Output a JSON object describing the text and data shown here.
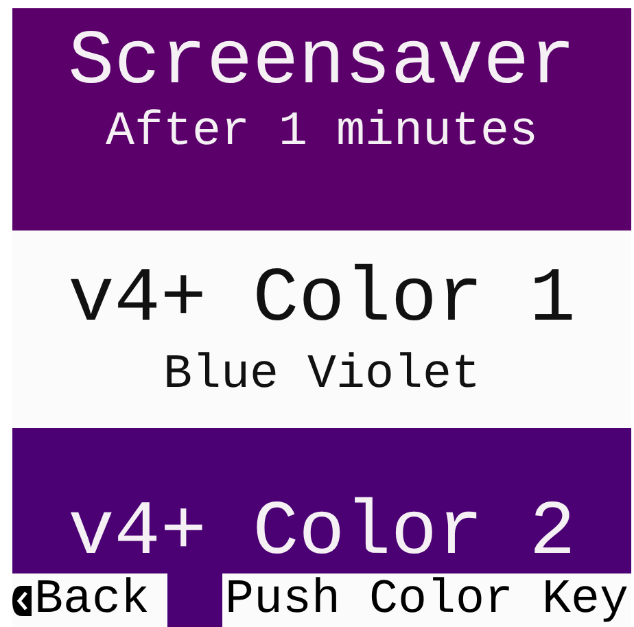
{
  "menu": [
    {
      "title": "Screensaver",
      "subtitle": "After 1 minutes",
      "selected": false,
      "color": "#5b006b"
    },
    {
      "title": "v4+ Color 1",
      "subtitle": "Blue Violet",
      "selected": true
    },
    {
      "title": "v4+ Color 2",
      "selected": false,
      "color": "#4b0073"
    }
  ],
  "softkeys": {
    "left": "Back",
    "right": "Push Color Key"
  }
}
